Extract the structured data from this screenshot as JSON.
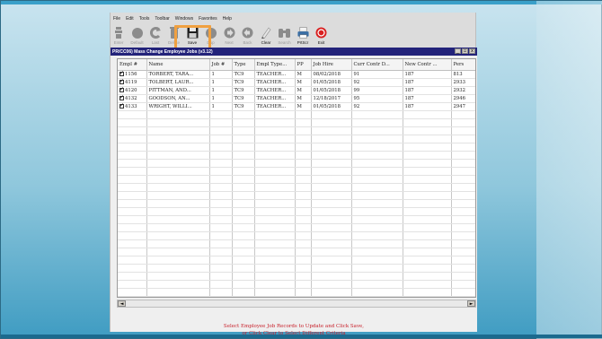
{
  "menu": [
    "File",
    "Edit",
    "Tools",
    "Toolbar",
    "Windows",
    "Favorites",
    "Help"
  ],
  "toolbar": [
    {
      "label": "Enter",
      "icon": "enter-icon",
      "enabled": false
    },
    {
      "label": "Default",
      "icon": "default-icon",
      "enabled": false
    },
    {
      "label": "Last",
      "icon": "last-icon",
      "enabled": false
    },
    {
      "label": "Delete",
      "icon": "delete-icon",
      "enabled": false
    },
    {
      "label": "Save",
      "icon": "save-icon",
      "enabled": true
    },
    {
      "label": "Dup",
      "icon": "duplicate-icon",
      "enabled": false
    },
    {
      "label": "Next",
      "icon": "next-icon",
      "enabled": false
    },
    {
      "label": "Back",
      "icon": "back-icon",
      "enabled": false
    },
    {
      "label": "Clear",
      "icon": "clear-icon",
      "enabled": true
    },
    {
      "label": "Search",
      "icon": "search-icon",
      "enabled": false
    },
    {
      "label": "PrtScr",
      "icon": "printer-icon",
      "enabled": true
    },
    {
      "label": "Exit",
      "icon": "exit-icon",
      "enabled": true
    }
  ],
  "window": {
    "title": "PR/CC06) Mass Change Employee Jobs (v3.12)",
    "minimize": "_",
    "restore": "▫",
    "close": "x"
  },
  "grid": {
    "columns": [
      "Empl #",
      "Name",
      "Job #",
      "Type",
      "Empl Type...",
      "PP",
      "Job Hire",
      "Curr Contr D...",
      "New Contr ...",
      "Pers"
    ],
    "rows": [
      {
        "checked": true,
        "cells": [
          "1156",
          "TORBERT, TARA...",
          "1",
          "TC9",
          "TEACHER...",
          "M",
          "08/02/2018",
          "91",
          "187",
          "813"
        ]
      },
      {
        "checked": true,
        "cells": [
          "4119",
          "TOLBERT, LAUR...",
          "1",
          "TC9",
          "TEACHER...",
          "M",
          "01/05/2018",
          "92",
          "187",
          "2933"
        ]
      },
      {
        "checked": true,
        "cells": [
          "4120",
          "PITTMAN, AND...",
          "1",
          "TC9",
          "TEACHER...",
          "M",
          "01/05/2018",
          "99",
          "187",
          "2932"
        ]
      },
      {
        "checked": true,
        "cells": [
          "4132",
          "GOODSON, AN...",
          "1",
          "TC9",
          "TEACHER...",
          "M",
          "12/18/2017",
          "95",
          "187",
          "2946"
        ]
      },
      {
        "checked": true,
        "cells": [
          "4133",
          "WRIGHT, WILLI...",
          "1",
          "TC9",
          "TEACHER...",
          "M",
          "01/05/2018",
          "92",
          "187",
          "2947"
        ]
      }
    ]
  },
  "scroll": {
    "left": "◄",
    "right": "►"
  },
  "status": {
    "line1": "Select Employee Job Records to Update and Click Save,",
    "line2": "or Click Clear to Select Different Criteria"
  },
  "colors": {
    "highlight": "#f0a040",
    "status_text": "#c8202a",
    "title_bar": "#23237a"
  }
}
